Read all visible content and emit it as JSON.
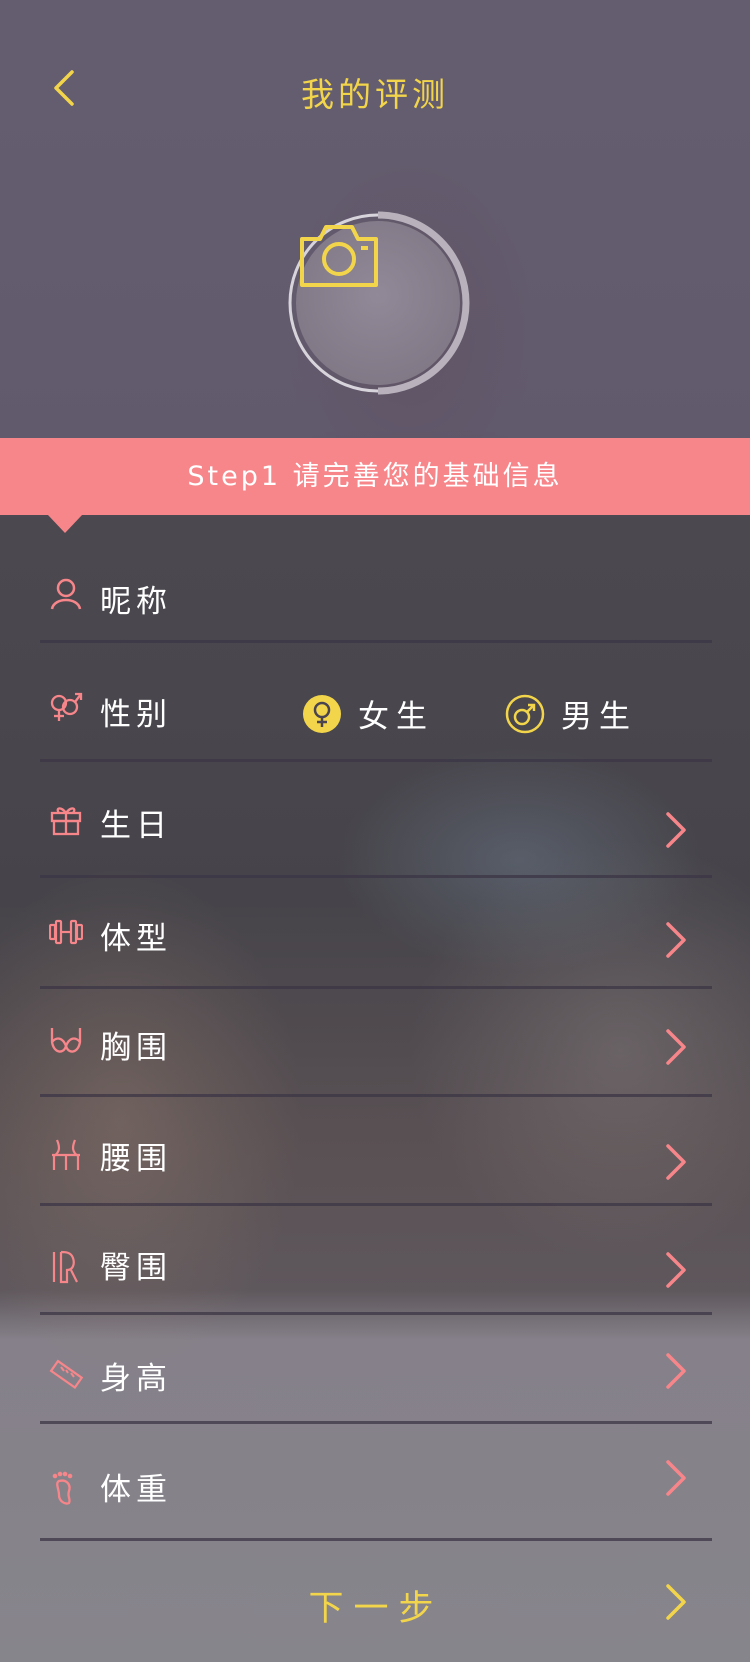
{
  "header": {
    "title": "我的评测"
  },
  "banner": {
    "text": "Step1  请完善您的基础信息"
  },
  "form": {
    "nickname": "昵称",
    "gender": "性别",
    "gender_female": "女生",
    "gender_male": "男生",
    "birthday": "生日",
    "body_type": "体型",
    "bust": "胸围",
    "waist": "腰围",
    "hip": "臀围",
    "height": "身高",
    "weight": "体重"
  },
  "footer": {
    "next_label": "下一步"
  },
  "colors": {
    "accent_yellow": "#f2d54a",
    "accent_pink": "#f7868b"
  }
}
